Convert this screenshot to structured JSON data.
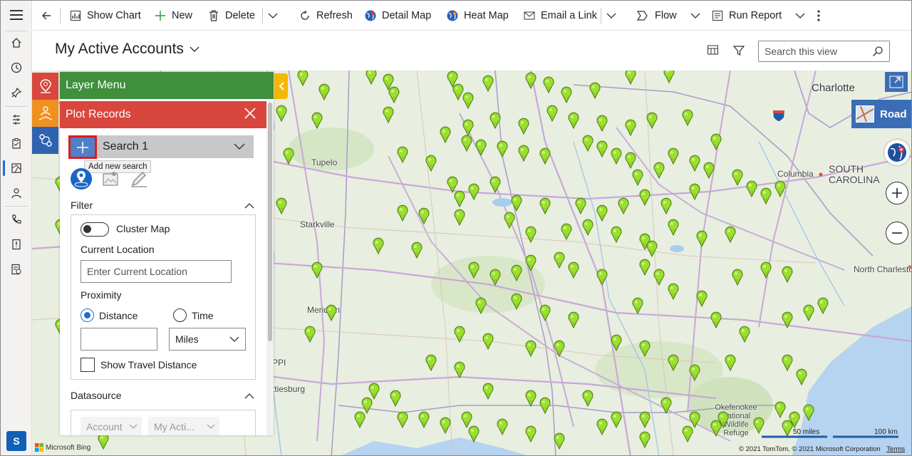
{
  "commands": {
    "back": "back",
    "show_chart": "Show Chart",
    "new": "New",
    "delete": "Delete",
    "refresh": "Refresh",
    "detail_map": "Detail Map",
    "heat_map": "Heat Map",
    "email_link": "Email a Link",
    "flow": "Flow",
    "run_report": "Run Report"
  },
  "header": {
    "view_title": "My Active Accounts",
    "search_placeholder": "Search this view"
  },
  "nav": {
    "user_initial": "S"
  },
  "panel": {
    "layer_menu": "Layer Menu",
    "plot_records": "Plot Records",
    "search_name": "Search 1",
    "add_tooltip": "Add new search",
    "filter": {
      "title": "Filter",
      "cluster_map": "Cluster Map",
      "current_location_label": "Current Location",
      "current_location_placeholder": "Enter Current Location",
      "proximity_label": "Proximity",
      "distance": "Distance",
      "time": "Time",
      "unit": "Miles",
      "show_travel_distance": "Show Travel Distance"
    },
    "datasource": {
      "title": "Datasource",
      "entity": "Account",
      "view": "My Acti..."
    }
  },
  "map": {
    "road_label": "Road",
    "places": [
      "Charlotte",
      "Tupelo",
      "Columbia",
      "SOUTH CAROLINA",
      "Starkville",
      "North Charleston",
      "Meridian",
      "PPI",
      "ttiesburg",
      "Okefenokee National Wildlife Refuge"
    ],
    "scale_miles": "50 miles",
    "scale_km": "100 km",
    "copyright": "© 2021 TomTom, © 2021 Microsoft Corporation",
    "terms": "Terms",
    "bing": "Microsoft Bing"
  }
}
